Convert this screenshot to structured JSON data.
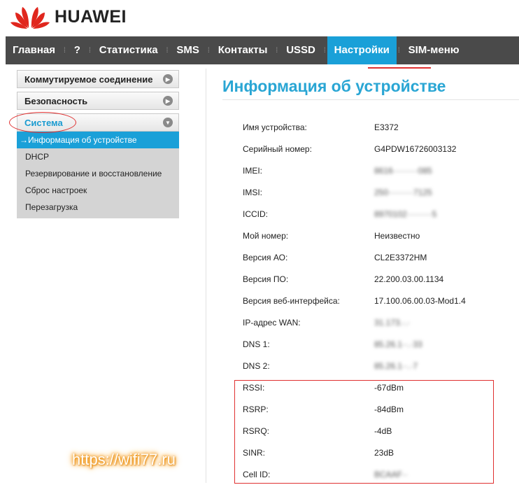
{
  "brand": {
    "name": "HUAWEI",
    "color": "#e0261d"
  },
  "nav": {
    "items": [
      {
        "label": "Главная"
      },
      {
        "label": "?"
      },
      {
        "label": "Статистика"
      },
      {
        "label": "SMS"
      },
      {
        "label": "Контакты"
      },
      {
        "label": "USSD"
      },
      {
        "label": "Настройки",
        "active": true
      },
      {
        "label": "SIM-меню"
      }
    ]
  },
  "sidebar": {
    "sections": [
      {
        "label": "Коммутируемое соединение",
        "icon": "chevron-right-icon"
      },
      {
        "label": "Безопасность",
        "icon": "chevron-right-icon"
      },
      {
        "label": "Система",
        "icon": "chevron-down-icon",
        "open": true
      }
    ],
    "subitems": [
      {
        "label": "Информация об устройстве",
        "active": true
      },
      {
        "label": "DHCP"
      },
      {
        "label": "Резервирование и восстановление"
      },
      {
        "label": "Сброс настроек"
      },
      {
        "label": "Перезагрузка"
      }
    ]
  },
  "main": {
    "title": "Информация об устройстве",
    "rows": [
      {
        "label": "Имя устройства:",
        "value": "E3372"
      },
      {
        "label": "Серийный номер:",
        "value": "G4PDW16726003132"
      },
      {
        "label": "IMEI:",
        "value": "8616·········085",
        "blurred": true
      },
      {
        "label": "IMSI:",
        "value": "250·········7125",
        "blurred": true
      },
      {
        "label": "ICCID:",
        "value": "8970102·········5",
        "blurred": true
      },
      {
        "label": "Мой номер:",
        "value": "Неизвестно"
      },
      {
        "label": "Версия АО:",
        "value": "CL2E3372HM"
      },
      {
        "label": "Версия ПО:",
        "value": "22.200.03.00.1134"
      },
      {
        "label": "Версия веб-интерфейса:",
        "value": "17.100.06.00.03-Mod1.4"
      },
      {
        "label": "IP-адрес WAN:",
        "value": "31.173.·.·",
        "blurred": true
      },
      {
        "label": "DNS 1:",
        "value": "85.26.1··.·33",
        "blurred": true
      },
      {
        "label": "DNS 2:",
        "value": "85.26.1··.·7",
        "blurred": true
      },
      {
        "label": "RSSI:",
        "value": "-67dBm"
      },
      {
        "label": "RSRP:",
        "value": "-84dBm"
      },
      {
        "label": "RSRQ:",
        "value": "-4dB"
      },
      {
        "label": "SINR:",
        "value": "23dB"
      },
      {
        "label": "Cell ID:",
        "value": "BCAAF··",
        "blurred": true
      }
    ]
  },
  "watermark": "https://wifi77.ru",
  "colors": {
    "accent": "#1aa0d8",
    "title": "#2aa6d4",
    "highlight": "#e03030",
    "navbar": "#4a4a4a"
  }
}
